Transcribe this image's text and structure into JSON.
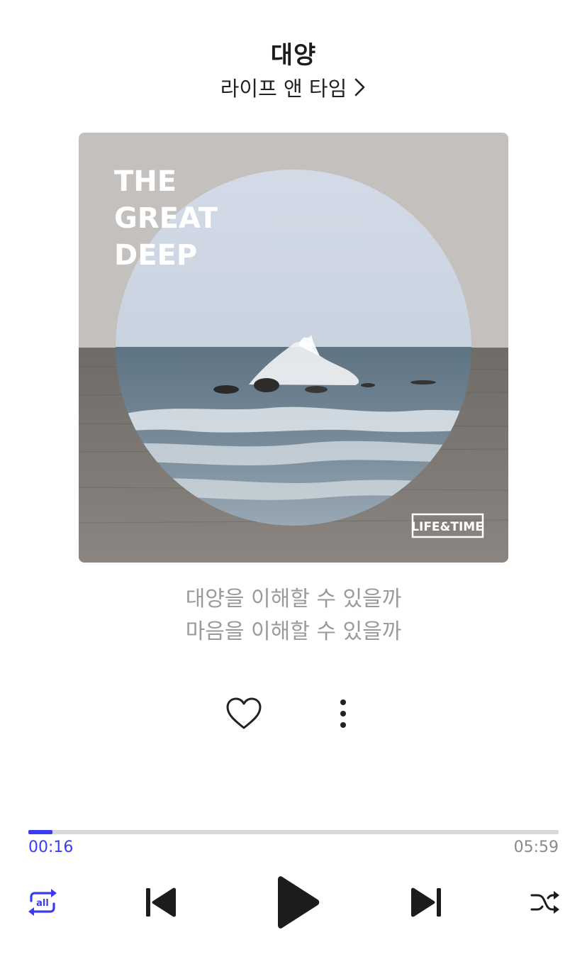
{
  "track": {
    "title": "대양",
    "artist": "라이프 앤 타임"
  },
  "album_art": {
    "title_lines": [
      "THE",
      "GREAT",
      "DEEP"
    ],
    "logo_text": "LIFE&TIME"
  },
  "lyrics": {
    "line1": "대양을 이해할 수 있을까",
    "line2": "마음을 이해할 수 있을까"
  },
  "actions": {
    "like_icon": "heart-outline-icon",
    "more_icon": "vertical-dots-icon"
  },
  "player": {
    "elapsed": "00:16",
    "total": "05:59",
    "progress_fraction": 0.045,
    "repeat_mode": "all",
    "accent_color": "#3b3bf0"
  },
  "controls": {
    "repeat_icon": "repeat-all-icon",
    "previous_icon": "skip-previous-icon",
    "play_icon": "play-icon",
    "next_icon": "skip-next-icon",
    "shuffle_icon": "shuffle-icon"
  }
}
